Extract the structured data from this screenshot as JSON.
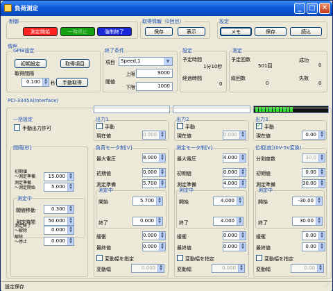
{
  "window": {
    "title": "負荷測定",
    "min": "_",
    "max": "□",
    "close": "✕"
  },
  "control": {
    "group": "制御",
    "start": "測定開始",
    "pause": "一時停止",
    "stop": "強制終了"
  },
  "acq": {
    "group": "取得情報（0回目）",
    "save": "保存",
    "show": "表示"
  },
  "settings": {
    "group": "設定",
    "memo": "メモ",
    "save": "保存",
    "load": "読込"
  },
  "info": {
    "group": "情報",
    "gpib": {
      "group": "GPIB設定",
      "init": "初期設定",
      "acq_item": "取得項目",
      "interval_label": "取得間隔",
      "interval_value": "0.100",
      "interval_unit": "秒",
      "manual_acq": "手動取得"
    },
    "end": {
      "group": "終了条件",
      "item_label": "項目",
      "item_value": "Speed,1",
      "upper_label": "上限",
      "upper_value": "9000",
      "thresh_label": "閾値",
      "lower_label": "下限",
      "lower_value": "1000"
    },
    "set": {
      "group": "設定",
      "planned_label": "予定時間",
      "planned_value": "1分10秒",
      "elapsed_label": "経過時間",
      "elapsed_value": "0"
    },
    "meas": {
      "group": "測定",
      "planned_count_label": "予定回数",
      "planned_count": "501回",
      "success_label": "成功",
      "success": "0",
      "total_label": "総回数",
      "total": "0",
      "fail_label": "失敗",
      "fail": "0"
    }
  },
  "pci": {
    "group": "PCI-3345A(Interface)",
    "bulk": {
      "group": "一括設定",
      "manual_out": "手動出力許可"
    },
    "interval": {
      "group": "間隔[秒]",
      "initial_label": "初期値\n～測定準備",
      "initial": "15.000",
      "prep_label": "測定準備\n～測定開始",
      "prep": "5.000",
      "meas_group": "測定中",
      "shift_label": "閾値移動",
      "shift": "0.300",
      "time_label": "測定時間",
      "time": "50.000",
      "end_label": "測定終了\n～解除",
      "end": "0.000",
      "release_label": "解除\n～停止",
      "release": "0.000"
    },
    "out1": {
      "header": "出力1",
      "manual": "手動",
      "current_label": "現在値",
      "current": "0.000",
      "sub": "負荷モータ制[V]",
      "max_label": "最大電圧",
      "max": "8.000",
      "init_label": "初期値",
      "init": "0.000",
      "prep_label": "測定準備",
      "prep": "5.700",
      "meas_group": "測定中",
      "start_label": "開始",
      "start": "5.700",
      "end_label": "終了",
      "end": "0.000",
      "buffer_label": "緩衝",
      "buffer": "0.000",
      "final_label": "最終値",
      "final": "0.000",
      "vary_label": "変動幅を指定",
      "vary_width_label": "変動幅",
      "vary_width": "0.000"
    },
    "out2": {
      "header": "出力2",
      "manual": "手動",
      "current_label": "現在値",
      "current": "0.000",
      "sub": "測定モータ制[V]",
      "max_label": "最大電圧",
      "max": "4.000",
      "init_label": "初期値",
      "init": "0.000",
      "prep_label": "測定準備",
      "prep": "4.000",
      "meas_group": "測定中",
      "start_label": "開始",
      "start": "4.000",
      "end_label": "終了",
      "end": "4.000",
      "buffer_label": "緩衝",
      "buffer": "0.000",
      "final_label": "最終値",
      "final": "0.000",
      "vary_label": "変動幅を指定",
      "vary_width_label": "変動幅",
      "vary_width": "0.000"
    },
    "out3": {
      "header": "出力3",
      "manual": "手動",
      "current_label": "現在値",
      "current": "0.00",
      "sub": "位相[度](0V-5V変換)",
      "div_label": "分割度数",
      "div": "30.0",
      "init_label": "初期値",
      "init": "0.00",
      "prep_label": "測定準備",
      "prep": "30.00",
      "meas_group": "測定中",
      "start_label": "開始",
      "start": "-30.00",
      "end_label": "終了",
      "end": "30.00",
      "buffer_label": "緩衝",
      "buffer": "0.00",
      "final_label": "最終値",
      "final": "0.00",
      "vary_label": "変動幅を指定",
      "vary_width_label": "変動幅",
      "vary_width": "0.00"
    }
  },
  "status": {
    "text": "設定保存"
  },
  "colors": {
    "start": "#ff2020",
    "pause": "#14a214",
    "stop": "#1a28d8",
    "title": "#0a58d8"
  }
}
